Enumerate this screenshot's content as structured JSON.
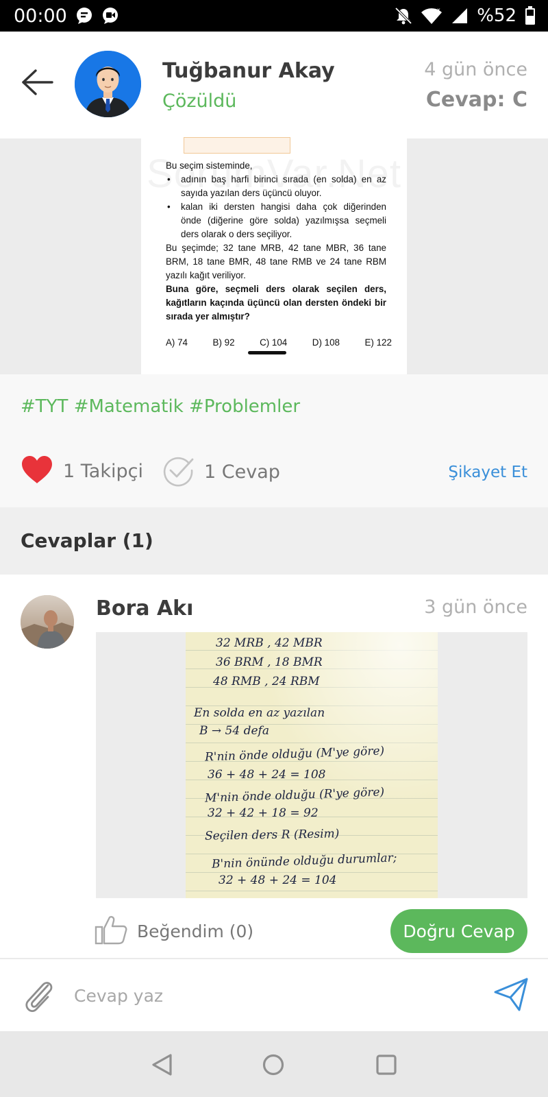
{
  "status_bar": {
    "time": "00:00",
    "battery": "%52"
  },
  "header": {
    "asker_name": "Tuğbanur Akay",
    "status": "Çözüldü",
    "time_ago": "4 gün önce",
    "answer_label": "Cevap: C"
  },
  "question": {
    "watermark": "SorumVar.Net",
    "intro": "Bu seçim sisteminde,",
    "bullets": [
      "adının baş harfi birinci sırada (en solda) en az sayıda yazılan ders üçüncü oluyor.",
      "kalan iki dersten hangisi daha çok diğerinden önde (diğerine göre solda) yazılmışsa seçmeli ders olarak o ders seçiliyor."
    ],
    "paragraph": "Bu şeçimde; 32 tane MRB, 42 tane MBR, 36 tane BRM, 18 tane BMR, 48 tane RMB ve 24 tane RBM yazılı kağıt veriliyor.",
    "prompt": "Buna göre, seçmeli ders olarak seçilen ders, kağıtların kaçında üçüncü olan dersten öndeki bir sırada yer almıştır?",
    "options": [
      "A) 74",
      "B) 92",
      "C) 104",
      "D) 108",
      "E) 122"
    ]
  },
  "tags": "#TYT #Matematik #Problemler",
  "stats": {
    "followers": "1 Takipçi",
    "answers": "1 Cevap",
    "report": "Şikayet Et"
  },
  "answers_section": {
    "title": "Cevaplar (1)"
  },
  "answer": {
    "name": "Bora Akı",
    "time_ago": "3 gün önce",
    "handwriting": [
      "32 MRB , 42 MBR",
      "36 BRM , 18 BMR",
      "48 RMB , 24 RBM",
      "En solda en az yazılan",
      "B → 54 defa",
      "R'nin önde olduğu (M'ye göre)",
      "36 + 48 + 24 = 108",
      "M'nin önde olduğu (R'ye göre)",
      "32 + 42 + 18 = 92",
      "Seçilen ders R (Resim)",
      "B'nin önünde olduğu durumlar;",
      "32 + 48 + 24 = 104"
    ],
    "like_label": "Beğendim (0)",
    "correct_label": "Doğru Cevap"
  },
  "reply": {
    "placeholder": "Cevap yaz"
  },
  "colors": {
    "accent_green": "#5cb85c",
    "link_blue": "#3a8fd9",
    "heart_red": "#e8333a",
    "avatar_blue": "#1877e6"
  },
  "icons": {
    "status_left": [
      "message-icon",
      "video-call-icon"
    ],
    "status_right": [
      "mute-icon",
      "wifi-icon",
      "signal-icon",
      "battery-icon"
    ],
    "header": [
      "back-arrow-icon"
    ],
    "stats": [
      "heart-icon",
      "check-circle-icon"
    ],
    "answer": [
      "thumbs-up-icon"
    ],
    "reply": [
      "paperclip-icon",
      "send-icon"
    ],
    "nav": [
      "nav-back-icon",
      "nav-home-icon",
      "nav-recent-icon"
    ]
  }
}
